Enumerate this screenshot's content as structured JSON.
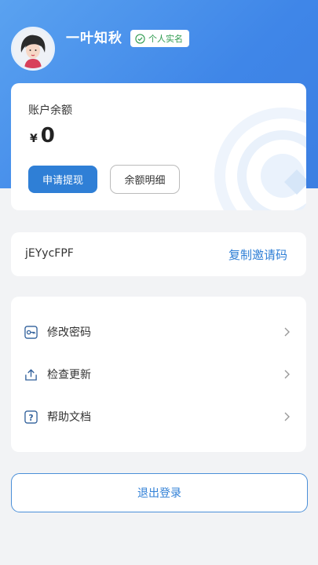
{
  "profile": {
    "username": "一叶知秋",
    "verify_badge": "个人实名"
  },
  "balance": {
    "title": "账户余额",
    "currency": "¥",
    "amount": "0",
    "withdraw_label": "申请提现",
    "detail_label": "余额明细"
  },
  "invite": {
    "code": "jEYycFPF",
    "copy_label": "复制邀请码"
  },
  "menu": {
    "items": [
      {
        "label": "修改密码",
        "icon": "key-icon"
      },
      {
        "label": "检查更新",
        "icon": "upload-icon"
      },
      {
        "label": "帮助文档",
        "icon": "help-icon"
      }
    ]
  },
  "logout_label": "退出登录",
  "colors": {
    "accent": "#2f7fd6",
    "hero_gradient_start": "#5aa2f0",
    "hero_gradient_end": "#3c7fe2",
    "verified": "#2f9b4f",
    "background": "#f2f3f5"
  }
}
